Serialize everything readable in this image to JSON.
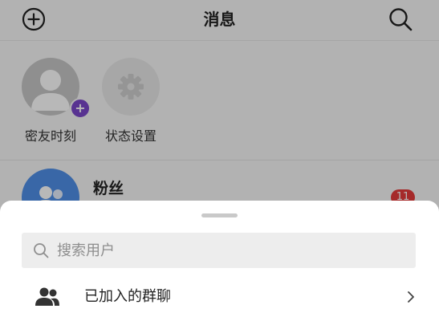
{
  "header": {
    "title": "消息",
    "add_icon": "plus-circle-icon",
    "search_icon": "search-icon"
  },
  "stories": [
    {
      "label": "密友时刻",
      "icon": "default-avatar-icon",
      "badge": "+",
      "badge_color": "#7b47c9"
    },
    {
      "label": "状态设置",
      "icon": "gear-icon"
    }
  ],
  "chat_list": [
    {
      "name": "粉丝",
      "icon": "group-avatar-icon",
      "unread": "11",
      "avatar_color": "#4f8fe8",
      "badge_color": "#e53b3b"
    }
  ],
  "sheet": {
    "search_placeholder": "搜索用户",
    "search_icon": "search-icon",
    "rows": [
      {
        "label": "已加入的群聊",
        "icon": "group-icon",
        "chevron_icon": "chevron-right-icon"
      }
    ]
  }
}
